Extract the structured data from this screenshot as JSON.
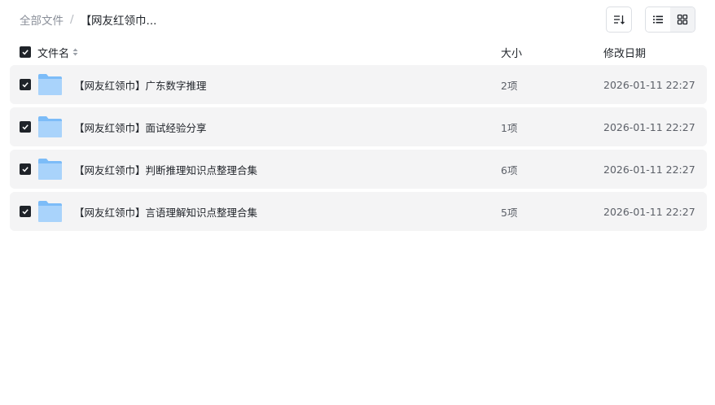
{
  "breadcrumb": {
    "root": "全部文件",
    "separator": "/",
    "current": "【网友红领巾..."
  },
  "toolbar": {
    "sort_icon": "sort-lines-icon",
    "list_view_icon": "list-view-icon",
    "grid_view_icon": "grid-view-icon",
    "active_view": "list"
  },
  "columns": {
    "name": "文件名",
    "size": "大小",
    "modified": "修改日期"
  },
  "rows": [
    {
      "name": "【网友红领巾】广东数字推理",
      "size": "2项",
      "modified": "2026-01-11 22:27",
      "checked": true,
      "icon": "folder-icon"
    },
    {
      "name": "【网友红领巾】面试经验分享",
      "size": "1项",
      "modified": "2026-01-11 22:27",
      "checked": true,
      "icon": "folder-icon"
    },
    {
      "name": "【网友红领巾】判断推理知识点整理合集",
      "size": "6项",
      "modified": "2026-01-11 22:27",
      "checked": true,
      "icon": "folder-icon"
    },
    {
      "name": "【网友红领巾】言语理解知识点整理合集",
      "size": "5项",
      "modified": "2026-01-11 22:27",
      "checked": true,
      "icon": "folder-icon"
    }
  ],
  "colors": {
    "row_background": "#f4f4f5",
    "folder_light": "#a9d3fb",
    "folder_dark": "#7cbcf8",
    "checkbox": "#1f2329"
  }
}
